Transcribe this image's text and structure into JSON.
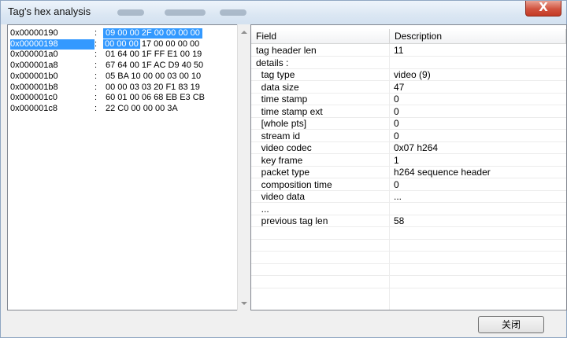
{
  "window": {
    "title": "Tag's hex analysis",
    "close_glyph": "X"
  },
  "hex_rows": [
    {
      "address": "0x00000190",
      "bytes": "09 00 00 2F 00 00 00 00",
      "selected": false
    },
    {
      "address": "0x00000198",
      "bytes_selected": "00 00 00",
      "bytes_rest": "17 00 00 00 00",
      "selected": true
    },
    {
      "address": "0x000001a0",
      "bytes": "01 64 00 1F FF E1 00 19",
      "selected": false
    },
    {
      "address": "0x000001a8",
      "bytes": "67 64 00 1F AC D9 40 50",
      "selected": false
    },
    {
      "address": "0x000001b0",
      "bytes": "05 BA 10 00 00 03 00 10",
      "selected": false
    },
    {
      "address": "0x000001b8",
      "bytes": "00 00 03 03 20 F1 83 19",
      "selected": false
    },
    {
      "address": "0x000001c0",
      "bytes": "60 01 00 06 68 EB E3 CB",
      "selected": false
    },
    {
      "address": "0x000001c8",
      "bytes": "22 C0 00 00 00 3A",
      "selected": false
    }
  ],
  "list": {
    "columns": {
      "field": "Field",
      "description": "Description"
    },
    "rows": [
      {
        "field": "tag header len",
        "description": "11"
      },
      {
        "field": "details :",
        "description": ""
      },
      {
        "field": "  tag type",
        "description": "video (9)"
      },
      {
        "field": "  data size",
        "description": "47"
      },
      {
        "field": "  time stamp",
        "description": "0"
      },
      {
        "field": "  time stamp ext",
        "description": "0"
      },
      {
        "field": "  [whole pts]",
        "description": "0"
      },
      {
        "field": "  stream id",
        "description": "0"
      },
      {
        "field": "  video codec",
        "description": "0x07  h264"
      },
      {
        "field": "  key frame",
        "description": "1"
      },
      {
        "field": "  packet type",
        "description": "h264 sequence header"
      },
      {
        "field": "  composition time",
        "description": "0"
      },
      {
        "field": "  video data",
        "description": "..."
      },
      {
        "field": "  ...",
        "description": ""
      },
      {
        "field": "  previous tag len",
        "description": "58"
      },
      {
        "field": "",
        "description": ""
      },
      {
        "field": "",
        "description": ""
      },
      {
        "field": "",
        "description": ""
      },
      {
        "field": "",
        "description": ""
      },
      {
        "field": "",
        "description": ""
      }
    ]
  },
  "buttons": {
    "close_label": "关闭"
  }
}
